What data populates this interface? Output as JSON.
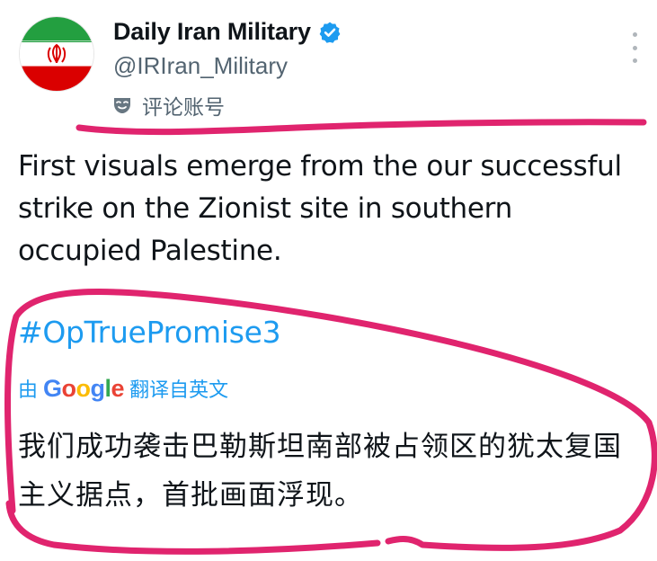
{
  "tweet": {
    "display_name": "Daily Iran Military",
    "handle": "@IRIran_Military",
    "comment_label": "评论账号",
    "text": "First visuals emerge from the our successful strike on the Zionist site in southern occupied Palestine.",
    "hashtag": "#OpTruePromise3",
    "translation": {
      "prefix": "由",
      "provider": "Google",
      "suffix": "翻译自英文",
      "text": "我们成功袭击巴勒斯坦南部被占领区的犹太复国主义据点，首批画面浮现。"
    }
  },
  "icons": {
    "avatar": "iran-flag-avatar",
    "verified": "verified-badge-icon",
    "comment_badge": "mask-icon",
    "more": "more-options-icon"
  },
  "colors": {
    "link_blue": "#1d9bf0",
    "annotation_pink": "#e0246e",
    "text_primary": "#0f1419",
    "text_secondary": "#536471"
  }
}
